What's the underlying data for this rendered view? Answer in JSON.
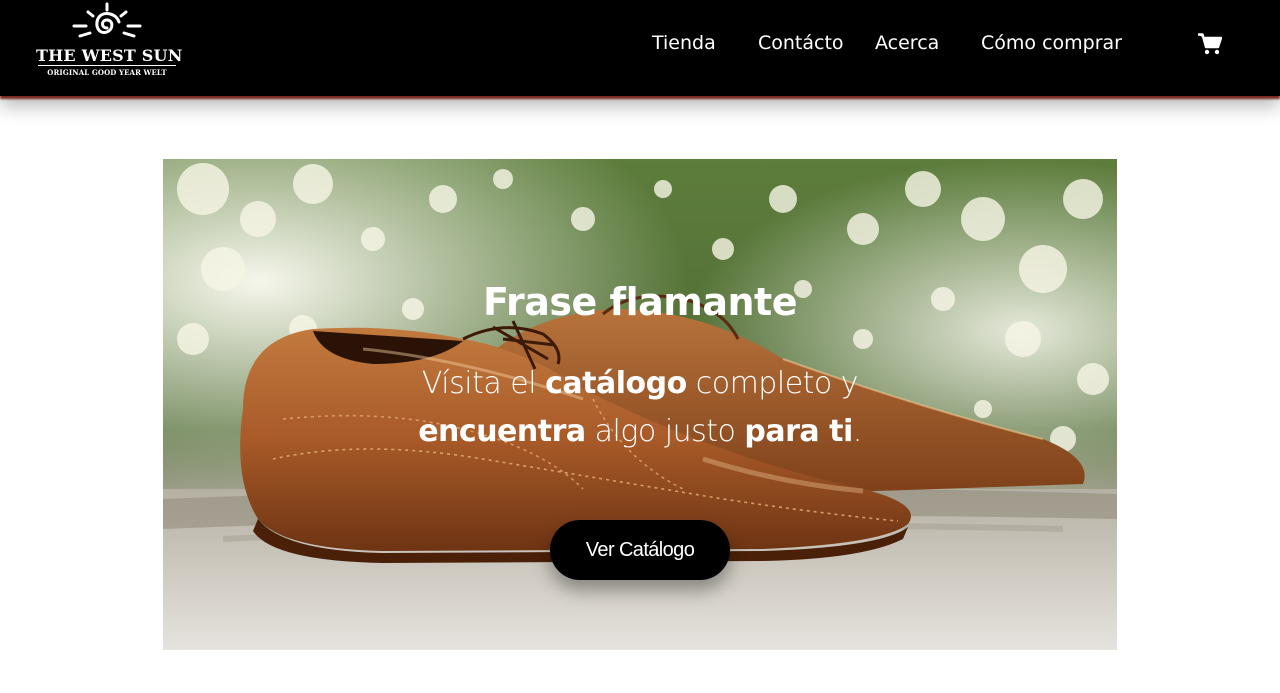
{
  "header": {
    "logo": {
      "title": "THE WEST SUN",
      "subtitle": "ORIGINAL GOOD YEAR WELT"
    },
    "nav": [
      {
        "label": "Tienda"
      },
      {
        "label": "Contácto"
      },
      {
        "label": "Acerca"
      },
      {
        "label": "Cómo comprar"
      }
    ],
    "cart_icon": "shopping-cart-icon"
  },
  "hero": {
    "image": "brown-leather-wingtip-brogue-shoes-photo",
    "title": "Frase flamante",
    "subtitle": {
      "p1": "Vísita el ",
      "b1": "catálogo",
      "p2": " completo y ",
      "b2": "encuentra",
      "p3": " algo justo ",
      "b3": "para ti",
      "p4": "."
    },
    "cta_label": "Ver Catálogo"
  },
  "colors": {
    "header_bg": "#000000",
    "header_shadow": "#7a2a22",
    "cta_bg": "#000000",
    "text_light": "#ffffff"
  }
}
